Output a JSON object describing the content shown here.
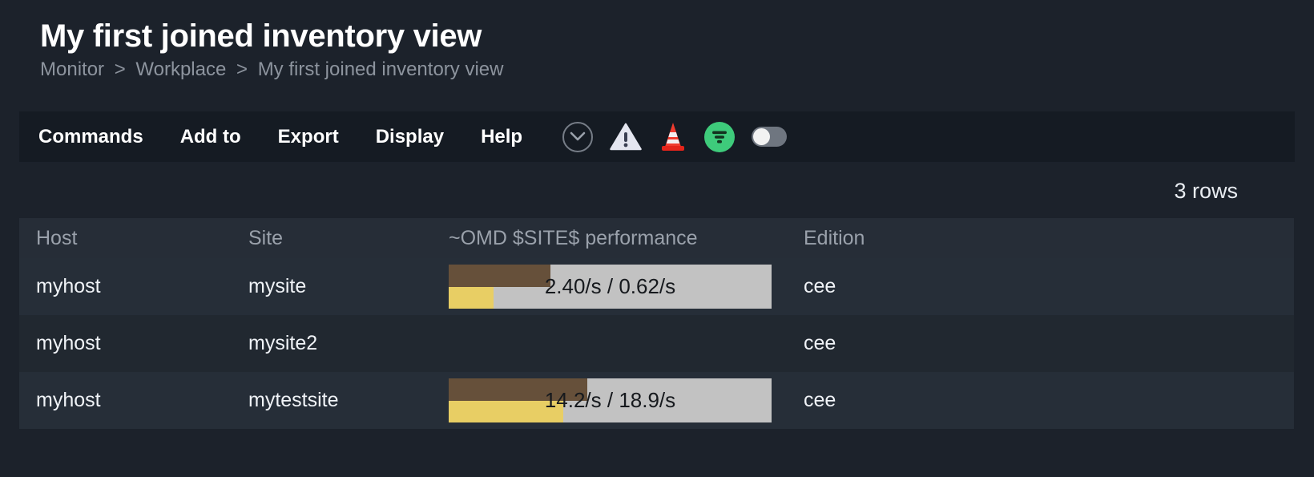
{
  "header": {
    "title": "My first joined inventory view",
    "breadcrumb": {
      "items": [
        "Monitor",
        "Workplace",
        "My first joined inventory view"
      ],
      "separator": ">"
    }
  },
  "toolbar": {
    "menu": [
      {
        "label": "Commands"
      },
      {
        "label": "Add to"
      },
      {
        "label": "Export"
      },
      {
        "label": "Display"
      },
      {
        "label": "Help"
      }
    ],
    "icons": [
      {
        "name": "chevron-down-circle-icon",
        "color": "#767d87"
      },
      {
        "name": "warning-triangle-icon",
        "color": "#e4e6f0"
      },
      {
        "name": "traffic-cone-icon",
        "color": "#f03b2e"
      },
      {
        "name": "filter-icon",
        "color": "#3ecb7b"
      },
      {
        "name": "toggle-switch",
        "state": "off",
        "color": "#6f7680"
      }
    ]
  },
  "status": {
    "rows_label": "3 rows"
  },
  "table": {
    "columns": [
      "Host",
      "Site",
      "~OMD $SITE$ performance",
      "Edition"
    ],
    "rows": [
      {
        "host": "myhost",
        "site": "mysite",
        "performance": {
          "label": "2.40/s / 0.62/s",
          "has_bar": true,
          "top_pct": 31.5,
          "bottom_pct": 13.9
        },
        "edition": "cee"
      },
      {
        "host": "myhost",
        "site": "mysite2",
        "performance": {
          "label": "",
          "has_bar": false,
          "top_pct": 0,
          "bottom_pct": 0
        },
        "edition": "cee"
      },
      {
        "host": "myhost",
        "site": "mytestsite",
        "performance": {
          "label": "14.2/s / 18.9/s",
          "has_bar": true,
          "top_pct": 43.0,
          "bottom_pct": 35.5
        },
        "edition": "cee"
      }
    ]
  },
  "colors": {
    "page_bg": "#1c222b",
    "toolbar_bg": "#151b23",
    "row_odd": "#262e38",
    "row_even": "#212830",
    "header_row": "#262d37",
    "bar_track": "#c2c2c2",
    "bar_top": "#66503a",
    "bar_bottom": "#e8ce64",
    "accent_green": "#3ecb7b",
    "accent_red": "#f03b2e"
  }
}
